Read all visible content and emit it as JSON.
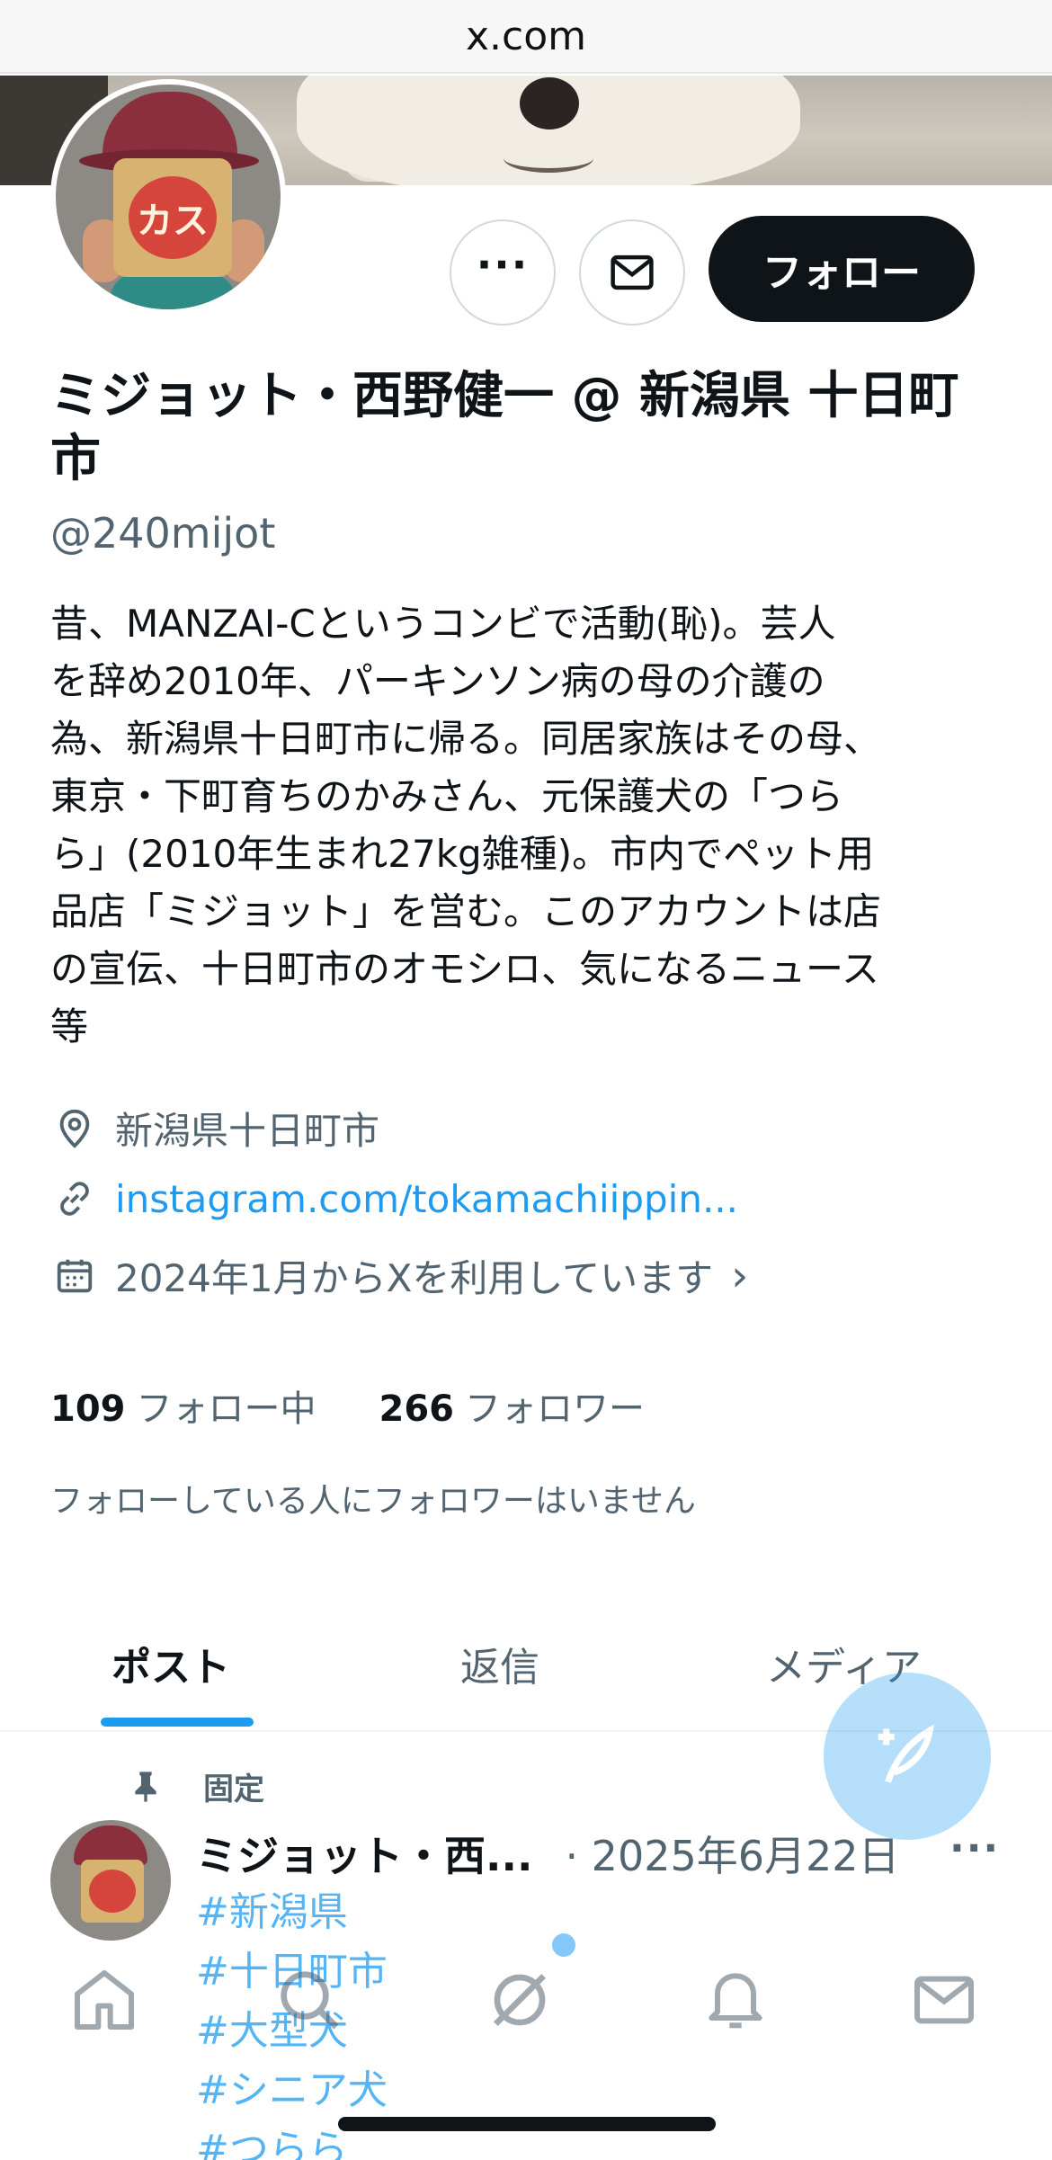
{
  "browser": {
    "url": "x.com"
  },
  "profile": {
    "display_name": "ミジョット・西野健一 @ 新潟県 十日町市",
    "handle": "@240mijot",
    "bio": "昔、MANZAI-Cというコンビで活動(恥)。芸人\nを辞め2010年、パーキンソン病の母の介護の\n為、新潟県十日町市に帰る。同居家族はその母、\n東京・下町育ちのかみさん、元保護犬の「つら\nら」(2010年生まれ27kg雑種)。市内でペット用\n品店「ミジョット」を営む。このアカウントは店\nの宣伝、十日町市のオモシロ、気になるニュース\n等",
    "location": "新潟県十日町市",
    "link": "instagram.com/tokamachiippin...",
    "joined": "2024年1月からXを利用しています",
    "avatar_text": "カス"
  },
  "actions": {
    "more": "more-icon",
    "message": "mail-icon",
    "follow_label": "フォロー"
  },
  "stats": {
    "following_count": "109",
    "following_label": "フォロー中",
    "followers_count": "266",
    "followers_label": "フォロワー",
    "no_mutual_text": "フォローしている人にフォロワーはいません"
  },
  "tabs": [
    {
      "label": "ポスト",
      "active": true
    },
    {
      "label": "返信",
      "active": false
    },
    {
      "label": "メディア",
      "active": false
    }
  ],
  "pinned_post": {
    "pinned_label": "固定",
    "author": "ミジョット・西...",
    "date": "· 2025年6月22日",
    "more": "···",
    "hashtags": [
      "#新潟県",
      "#十日町市",
      "#大型犬",
      "#シニア犬",
      "#つらら"
    ]
  },
  "bottom_nav": [
    "home-icon",
    "search-icon",
    "grok-icon",
    "notifications-icon",
    "messages-icon"
  ],
  "colors": {
    "accent": "#1d9bf0",
    "text": "#0f1419",
    "secondary": "#536471",
    "follow_button": "#0f1419"
  }
}
